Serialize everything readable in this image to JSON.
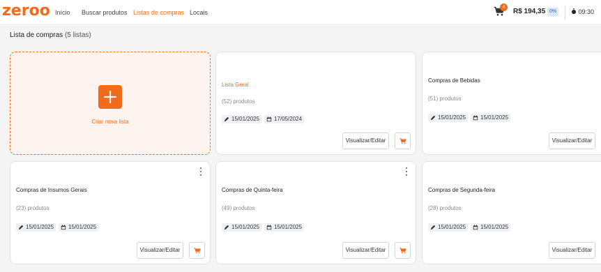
{
  "header": {
    "logo": "zeroo",
    "nav": [
      "Início",
      "Buscar produtos",
      "Listas de compras",
      "Locais"
    ],
    "active_nav": "Listas de compras",
    "cart_badge": "4",
    "cart_total": "R$ 194,35",
    "discount_badge": "0%",
    "timer": "09:30"
  },
  "page": {
    "title": "Lista de compras",
    "count": "(5 listas)"
  },
  "new_list": {
    "label": "Criar nova lista"
  },
  "lists": [
    {
      "name": "Lista Geral",
      "count": "(52) produtos",
      "edited": "15/01/2025",
      "created": "17/05/2024",
      "view_label": "Visualizar/Editar"
    },
    {
      "name": "Compras de Bebidas",
      "count": "(51) produtos",
      "edited": "15/01/2025",
      "created": "15/01/2025",
      "view_label": "Visualizar/Editar"
    },
    {
      "name": "Compras de Insumos Gerais",
      "count": "(23) produtos",
      "edited": "15/01/2025",
      "created": "15/01/2025",
      "view_label": "Visualizar/Editar"
    },
    {
      "name": "Compras de Quinta-feira",
      "count": "(49) produtos",
      "edited": "15/01/2025",
      "created": "15/01/2025",
      "view_label": "Visualizar/Editar"
    },
    {
      "name": "Compras de Segunda-feira",
      "count": "(28) produtos",
      "edited": "15/01/2025",
      "created": "15/01/2025",
      "view_label": "Visualizar/Editar"
    }
  ],
  "colors": {
    "accent": "#f26b1d",
    "chip_bg": "#eef0f3",
    "page_bg": "#f4f4f5"
  },
  "icons": {
    "cart": "cart-icon",
    "pencil": "pencil-icon",
    "calendar": "calendar-icon",
    "plus": "plus-icon",
    "timer": "stopwatch-icon",
    "menu": "kebab-menu-icon"
  }
}
